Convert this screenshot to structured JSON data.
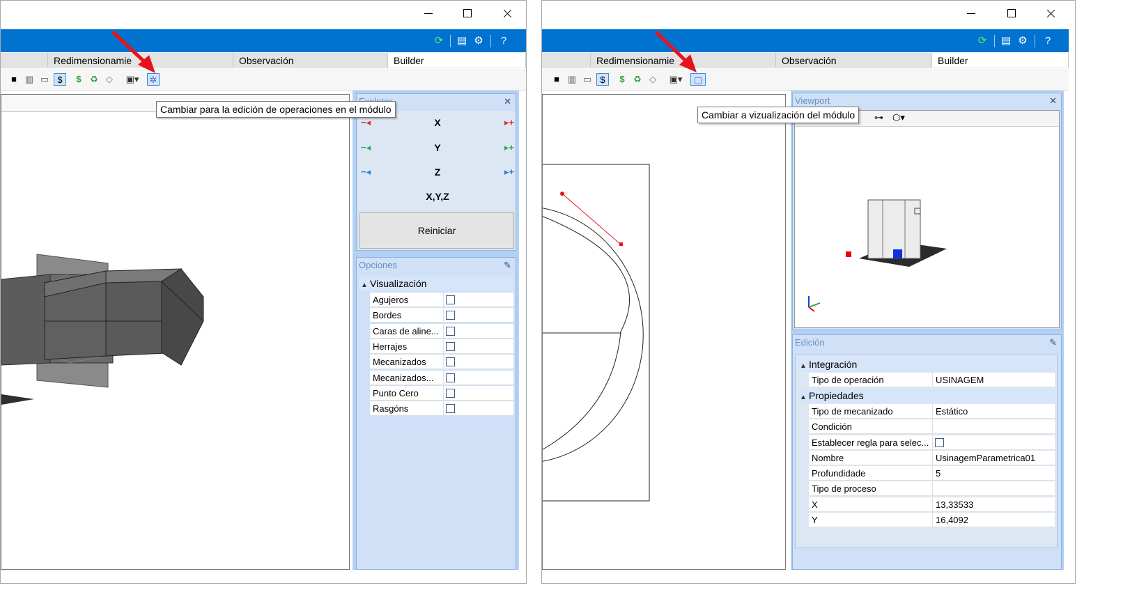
{
  "left": {
    "blue_icons": [
      "refresh-icon",
      "layout-icon",
      "settings-icon",
      "help-icon"
    ],
    "tabs": [
      {
        "label": "Redimensionamie"
      },
      {
        "label": "Observación"
      },
      {
        "label": "Builder"
      }
    ],
    "tooltip": "Cambiar para la edición de operaciones en el módulo",
    "explode": {
      "title": "Explotar",
      "axes": [
        "X",
        "Y",
        "Z",
        "X,Y,Z"
      ],
      "reset_label": "Reiniciar",
      "colors": [
        "#e03030",
        "#27ae60",
        "#2f7fd4"
      ]
    },
    "options": {
      "title": "Opciones",
      "group": "Visualización",
      "rows": [
        {
          "label": "Agujeros",
          "checked": false
        },
        {
          "label": "Bordes",
          "checked": false
        },
        {
          "label": "Caras de aline...",
          "checked": false
        },
        {
          "label": "Herrajes",
          "checked": false
        },
        {
          "label": "Mecanizados",
          "checked": false
        },
        {
          "label": "Mecanizados...",
          "checked": false
        },
        {
          "label": "Punto Cero",
          "checked": false
        },
        {
          "label": "Rasgóns",
          "checked": false
        }
      ]
    }
  },
  "right": {
    "tabs": [
      {
        "label": "Redimensionamie"
      },
      {
        "label": "Observación"
      },
      {
        "label": "Builder"
      }
    ],
    "tooltip": "Cambiar a vizualización del módulo",
    "viewport_panel": {
      "title": "Viewport"
    },
    "edicion": {
      "title": "Edición",
      "groups": [
        {
          "label": "Integración",
          "rows": [
            {
              "label": "Tipo de operación",
              "value": "USINAGEM"
            }
          ]
        },
        {
          "label": "Propiedades",
          "rows": [
            {
              "label": "Tipo de mecanizado",
              "value": "Estático"
            },
            {
              "label": "Condición",
              "value": ""
            },
            {
              "label": "Establecer regla para selec...",
              "value": "",
              "checkbox": true
            },
            {
              "label": "Nombre",
              "value": "UsinagemParametrica01"
            },
            {
              "label": "Profundidade",
              "value": "5"
            },
            {
              "label": "Tipo de proceso",
              "value": ""
            },
            {
              "label": "X",
              "value": "13,33533"
            },
            {
              "label": "Y",
              "value": "16,4092"
            }
          ]
        }
      ]
    }
  },
  "colors": {
    "accent": "#0073d1",
    "arrow": "#e8121a",
    "panel": "#cfe0f7"
  }
}
